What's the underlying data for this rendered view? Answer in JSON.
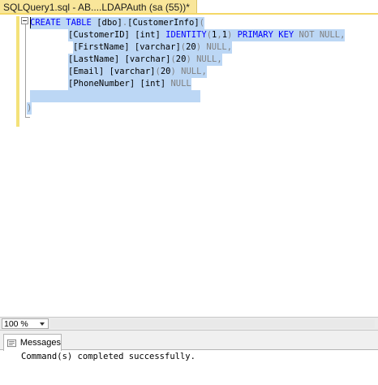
{
  "window": {
    "tab_title": "SQLQuery1.sql - AB....LDAPAuth (sa (55))*"
  },
  "editor": {
    "line1": {
      "kw1": "CREATE",
      "kw2": "TABLE",
      "obj": "[dbo]",
      "dot": ".",
      "obj2": "[CustomerInfo]",
      "paren": "("
    },
    "line2": {
      "col": "[CustomerID]",
      "type": "[int]",
      "ident": "IDENTITY",
      "p1": "(",
      "n1": "1",
      "comma": ",",
      "n2": "1",
      "p2": ")",
      "pk": "PRIMARY KEY",
      "nn": "NOT NULL",
      "end": ","
    },
    "line3": {
      "col": "[FirstName]",
      "type": "[varchar]",
      "p1": "(",
      "n": "20",
      "p2": ")",
      "nl": "NULL",
      "end": ","
    },
    "line4": {
      "col": "[LastName]",
      "type": "[varchar]",
      "p1": "(",
      "n": "20",
      "p2": ")",
      "nl": "NULL",
      "end": ","
    },
    "line5": {
      "col": "[Email]",
      "type": "[varchar]",
      "p1": "(",
      "n": "20",
      "p2": ")",
      "nl": "NULL",
      "end": ","
    },
    "line6": {
      "col": "[PhoneNumber]",
      "type": "[int]",
      "nl": "NULL"
    },
    "line8": {
      "paren": ")"
    }
  },
  "zoom": {
    "value": "100 %"
  },
  "results": {
    "tab_label": "Messages",
    "message": "Command(s) completed successfully."
  },
  "colors": {
    "keyword": "#0000ff",
    "operator": "#808080",
    "function": "#ff00ff",
    "selection": "#bcd7f5",
    "active_tab": "#f9e69a",
    "change_marker": "#f4e27a"
  }
}
